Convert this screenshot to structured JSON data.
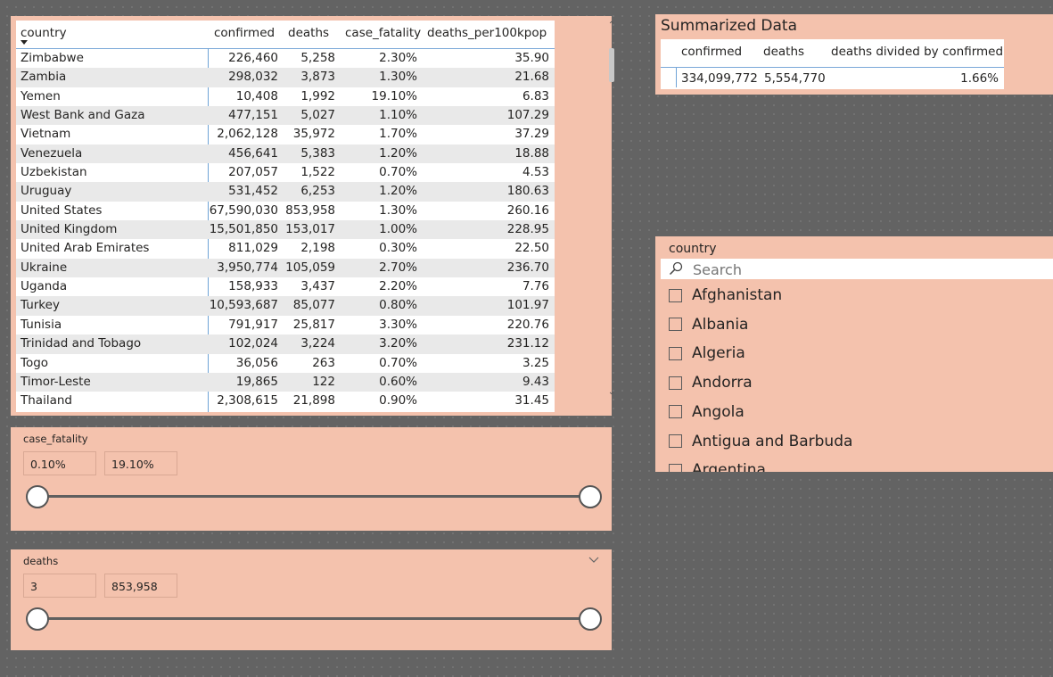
{
  "table": {
    "headers": [
      "country",
      "confirmed",
      "deaths",
      "case_fatality",
      "deaths_per100kpop"
    ],
    "rows": [
      [
        "Zimbabwe",
        "226,460",
        "5,258",
        "2.30%",
        "35.90"
      ],
      [
        "Zambia",
        "298,032",
        "3,873",
        "1.30%",
        "21.68"
      ],
      [
        "Yemen",
        "10,408",
        "1,992",
        "19.10%",
        "6.83"
      ],
      [
        "West Bank and Gaza",
        "477,151",
        "5,027",
        "1.10%",
        "107.29"
      ],
      [
        "Vietnam",
        "2,062,128",
        "35,972",
        "1.70%",
        "37.29"
      ],
      [
        "Venezuela",
        "456,641",
        "5,383",
        "1.20%",
        "18.88"
      ],
      [
        "Uzbekistan",
        "207,057",
        "1,522",
        "0.70%",
        "4.53"
      ],
      [
        "Uruguay",
        "531,452",
        "6,253",
        "1.20%",
        "180.63"
      ],
      [
        "United States",
        "67,590,030",
        "853,958",
        "1.30%",
        "260.16"
      ],
      [
        "United Kingdom",
        "15,501,850",
        "153,017",
        "1.00%",
        "228.95"
      ],
      [
        "United Arab Emirates",
        "811,029",
        "2,198",
        "0.30%",
        "22.50"
      ],
      [
        "Ukraine",
        "3,950,774",
        "105,059",
        "2.70%",
        "236.70"
      ],
      [
        "Uganda",
        "158,933",
        "3,437",
        "2.20%",
        "7.76"
      ],
      [
        "Turkey",
        "10,593,687",
        "85,077",
        "0.80%",
        "101.97"
      ],
      [
        "Tunisia",
        "791,917",
        "25,817",
        "3.30%",
        "220.76"
      ],
      [
        "Trinidad and Tobago",
        "102,024",
        "3,224",
        "3.20%",
        "231.12"
      ],
      [
        "Togo",
        "36,056",
        "263",
        "0.70%",
        "3.25"
      ],
      [
        "Timor-Leste",
        "19,865",
        "122",
        "0.60%",
        "9.43"
      ],
      [
        "Thailand",
        "2,308,615",
        "21,898",
        "0.90%",
        "31.45"
      ]
    ]
  },
  "summary": {
    "title": "Summarized Data",
    "headers": [
      "confirmed",
      "deaths",
      "deaths divided by confirmed"
    ],
    "values": [
      "334,099,772",
      "5,554,770",
      "1.66%"
    ]
  },
  "country_slicer": {
    "title": "country",
    "search_placeholder": "Search",
    "items": [
      "Afghanistan",
      "Albania",
      "Algeria",
      "Andorra",
      "Angola",
      "Antigua and Barbuda",
      "Argentina"
    ]
  },
  "case_fatality_slicer": {
    "title": "case_fatality",
    "min": "0.10%",
    "max": "19.10%"
  },
  "deaths_slicer": {
    "title": "deaths",
    "min": "3",
    "max": "853,958"
  },
  "icons": {
    "sort": "sort-desc-icon",
    "scroll_up": "chevron-up-icon",
    "scroll_down": "chevron-down-icon",
    "search": "search-icon",
    "collapse": "chevron-down-icon"
  },
  "colors": {
    "canvas": "#636363",
    "panel": "#f4c2ad",
    "accent_line": "#6ea3d6"
  }
}
